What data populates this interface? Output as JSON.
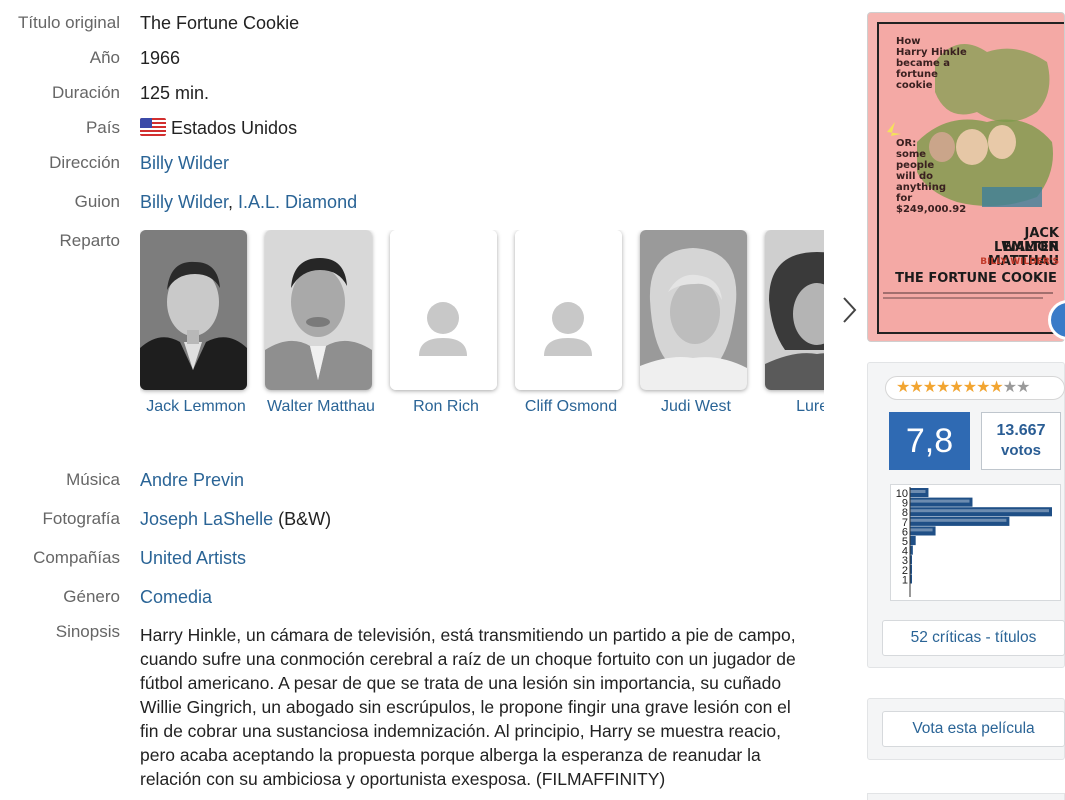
{
  "details": {
    "original_title": {
      "label": "Título original",
      "value": "The Fortune Cookie"
    },
    "year": {
      "label": "Año",
      "value": "1966"
    },
    "duration": {
      "label": "Duración",
      "value": "125 min."
    },
    "country": {
      "label": "País",
      "value": "Estados Unidos",
      "flag_icon": "us-flag-icon"
    },
    "direction": {
      "label": "Dirección",
      "names": [
        "Billy Wilder"
      ]
    },
    "screenplay": {
      "label": "Guion",
      "names": [
        "Billy Wilder",
        "I.A.L. Diamond"
      ],
      "separator": ", "
    },
    "cast": {
      "label": "Reparto",
      "members": [
        {
          "name": "Jack Lemmon",
          "has_photo": true
        },
        {
          "name": "Walter Matthau",
          "has_photo": true
        },
        {
          "name": "Ron Rich",
          "has_photo": false
        },
        {
          "name": "Cliff Osmond",
          "has_photo": false
        },
        {
          "name": "Judi West",
          "has_photo": true
        },
        {
          "name": "Lurene",
          "has_photo": true
        }
      ],
      "next_icon": "chevron-right-icon"
    },
    "music": {
      "label": "Música",
      "names": [
        "Andre Previn"
      ]
    },
    "photography": {
      "label": "Fotografía",
      "names": [
        "Joseph LaShelle"
      ],
      "note": " (B&W)"
    },
    "companies": {
      "label": "Compañías",
      "names": [
        "United Artists"
      ]
    },
    "genre": {
      "label": "Género",
      "names": [
        "Comedia"
      ]
    },
    "synopsis": {
      "label": "Sinopsis",
      "lines": [
        "Harry Hinkle, un cámara de televisión, está transmitiendo un partido a pie de campo,",
        "cuando sufre una conmoción cerebral a raíz de un choque fortuito con un jugador de",
        "fútbol americano. A pesar de que se trata de una lesión sin importancia, su cuñado",
        "Willie Gingrich, un abogado sin escrúpulos, le propone fingir una grave lesión con el",
        "fin de cobrar una sustanciosa indemnización. Al principio, Harry se muestra reacio,",
        "pero acaba aceptando la propuesta porque alberga la esperanza de reanudar la",
        "relación con su ambiciosa y oportunista exesposa. (FILMAFFINITY)"
      ]
    }
  },
  "poster": {
    "tagline_top": [
      "How",
      "Harry Hinkle",
      "became a",
      "fortune",
      "cookie"
    ],
    "tagline_bottom": [
      "OR:",
      "some",
      "people",
      "will do",
      "anything",
      "for",
      "$249,000.92"
    ],
    "star_1": "JACK LEMMON",
    "star_2": "WALTER MATTHAU",
    "credit": "BILLY WILDER'S",
    "title": "THE FORTUNE COOKIE"
  },
  "rating": {
    "stars_filled": 8,
    "stars_total": 10,
    "average": "7,8",
    "votes_count": "13.667",
    "votes_label": "votos",
    "histogram": {
      "scores": [
        10,
        9,
        8,
        7,
        6,
        5,
        4,
        3,
        2,
        1
      ],
      "relative_share": [
        0.13,
        0.44,
        1.0,
        0.7,
        0.18,
        0.04,
        0.02,
        0.01,
        0.01,
        0.01
      ]
    },
    "critics_link": "52 críticas - títulos",
    "vote_button": "Vota esta película"
  },
  "colors": {
    "link": "#2a6496",
    "rating_blue": "#2f6ab3",
    "star_on": "#f2a531",
    "histogram_bar": "#1f4f86"
  }
}
